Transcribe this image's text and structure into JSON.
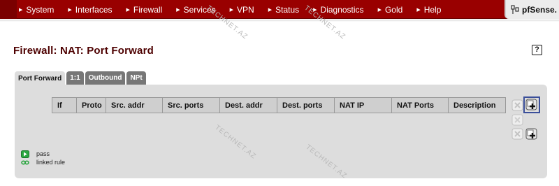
{
  "nav": {
    "items": [
      {
        "label": "System"
      },
      {
        "label": "Interfaces"
      },
      {
        "label": "Firewall"
      },
      {
        "label": "Services"
      },
      {
        "label": "VPN"
      },
      {
        "label": "Status"
      },
      {
        "label": "Diagnostics"
      },
      {
        "label": "Gold"
      },
      {
        "label": "Help"
      }
    ],
    "brand": "pfSense."
  },
  "page": {
    "title": "Firewall: NAT: Port Forward",
    "help_label": "?"
  },
  "tabs": [
    {
      "label": "Port Forward",
      "active": true
    },
    {
      "label": "1:1",
      "active": false
    },
    {
      "label": "Outbound",
      "active": false
    },
    {
      "label": "NPt",
      "active": false
    }
  ],
  "table": {
    "headers": [
      "If",
      "Proto",
      "Src. addr",
      "Src. ports",
      "Dest. addr",
      "Dest. ports",
      "NAT IP",
      "NAT Ports",
      "Description"
    ],
    "rows": []
  },
  "legend": {
    "pass": "pass",
    "linked": "linked rule"
  },
  "watermark": "TECHNET.AZ",
  "colors": {
    "nav_bg": "#990000",
    "title": "#4d0000",
    "panel": "#dddddd",
    "tab_inactive": "#777777",
    "pass_icon": "#2ba640",
    "focus_border": "#3b4f9a"
  }
}
